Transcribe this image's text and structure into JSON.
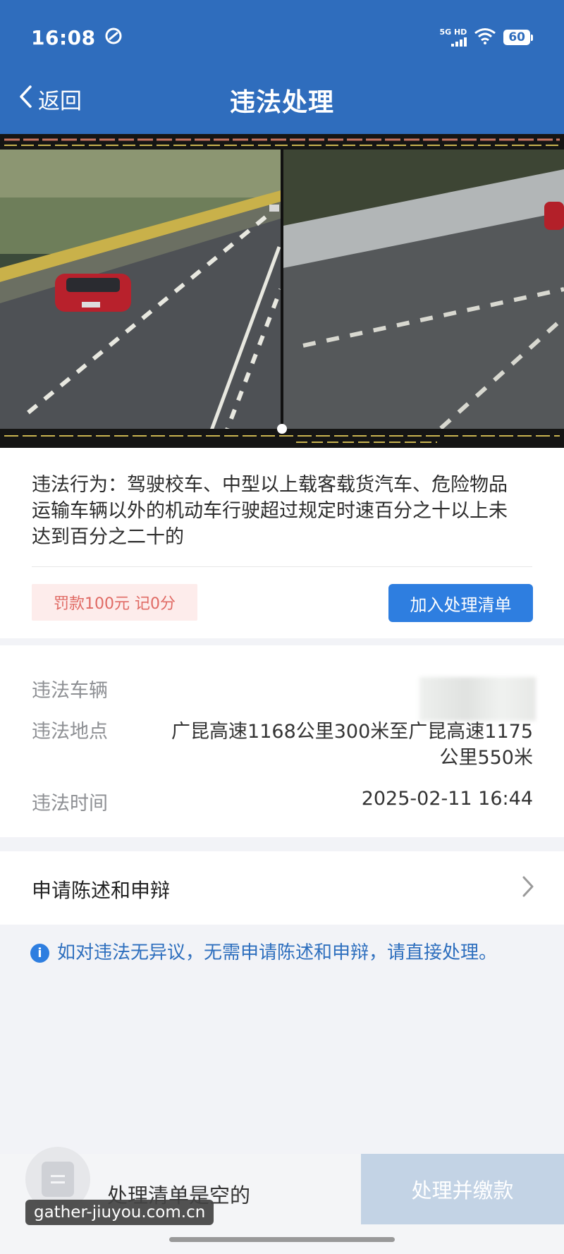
{
  "status_bar": {
    "time": "16:08",
    "network": "5G HD",
    "battery": "60",
    "icons": [
      "sync-icon",
      "signal-icon",
      "wifi-icon",
      "battery-icon"
    ]
  },
  "nav": {
    "back_label": "返回",
    "title": "违法处理"
  },
  "violation": {
    "behavior_text": "违法行为：驾驶校车、中型以上载客载货汽车、危险物品运输车辆以外的机动车行驶超过规定时速百分之十以上未达到百分之二十的",
    "penalty": "罚款100元 记0分",
    "add_to_list_label": "加入处理清单"
  },
  "details": {
    "vehicle_label": "违法车辆",
    "location_label": "违法地点",
    "location_line1": "广昆高速1168公里300米至广昆高速1175",
    "location_line2": "公里550米",
    "time_label": "违法时间",
    "time_value": "2025-02-11 16:44"
  },
  "appeal": {
    "label": "申请陈述和申辩"
  },
  "notice": {
    "text": "如对违法无异议，无需申请陈述和申辩，请直接处理。"
  },
  "bottom": {
    "empty_text": "处理清单是空的",
    "pay_label": "处理并缴款"
  },
  "watermark": "gather-jiuyou.com.cn",
  "colors": {
    "header_blue": "#2f6dbd",
    "button_blue": "#2e7ee0",
    "penalty_red": "#e06a64",
    "notice_blue": "#2e6fbe",
    "pay_disabled": "#c3d3e5"
  }
}
